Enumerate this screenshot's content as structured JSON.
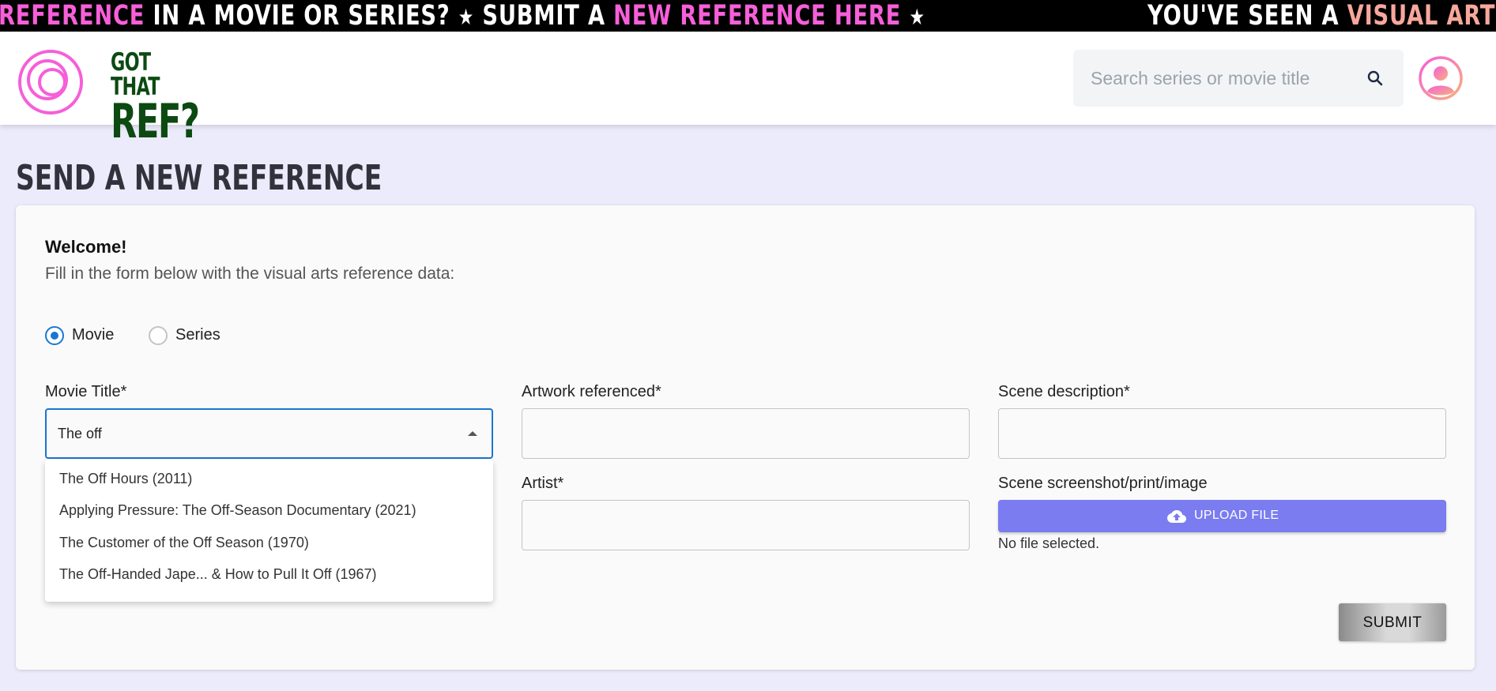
{
  "banner": {
    "segment1_white_start": "REFERENCE",
    "segment1_white_mid": " IN A MOVIE OR SERIES?",
    "star": "★",
    "segment2_white": "SUBMIT A ",
    "segment2_pink": "NEW REFERENCE HERE",
    "segment3_white": "YOU'VE SEEN A ",
    "segment3_peach": "VISUAL ARTS"
  },
  "header": {
    "logo_line1": "GOT THAT",
    "logo_line2": "REF?",
    "search_placeholder": "Search series or movie title"
  },
  "page": {
    "title": "SEND A NEW REFERENCE"
  },
  "form": {
    "welcome": "Welcome!",
    "intro": "Fill in the form below with the visual arts reference data:",
    "media_type_options": [
      "Movie",
      "Series"
    ],
    "media_type_selected": "Movie",
    "movie_title_label": "Movie Title*",
    "movie_title_value": "The off",
    "artwork_label": "Artwork referenced*",
    "artwork_value": "",
    "scene_description_label": "Scene description*",
    "scene_description_value": "",
    "artist_label": "Artist*",
    "artist_value": "",
    "scene_image_label": "Scene screenshot/print/image",
    "upload_button_label": "UPLOAD FILE",
    "upload_status": "No file selected.",
    "submit_label": "SUBMIT"
  },
  "autocomplete": {
    "options": [
      "The Off Hours (2011)",
      "Applying Pressure: The Off-Season Documentary (2021)",
      "The Customer of the Off Season (1970)",
      "The Off-Handed Jape... & How to Pull It Off (1967)"
    ]
  },
  "colors": {
    "accent_pink": "#f65fd9",
    "accent_purple": "#7a7cf0",
    "logo_green": "#0c4a12",
    "focus_blue": "#1976d2",
    "page_background": "#ecebfb"
  },
  "icons": {
    "search": "search-icon",
    "avatar": "user-avatar-icon",
    "upload": "cloud-upload-icon",
    "dropdown": "caret-up-icon"
  }
}
